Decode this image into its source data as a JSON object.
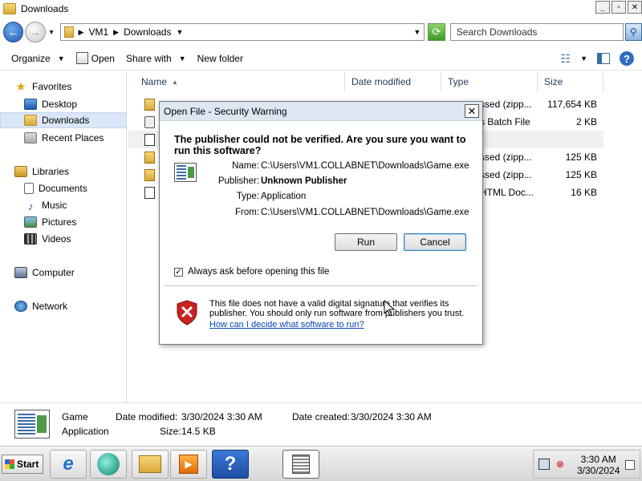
{
  "window": {
    "title": "Downloads"
  },
  "address": {
    "crumbs": [
      "VM1",
      "Downloads"
    ],
    "search_placeholder": "Search Downloads"
  },
  "toolbar": {
    "organize": "Organize",
    "open": "Open",
    "share_with": "Share with",
    "new_folder": "New folder"
  },
  "nav": {
    "favorites": "Favorites",
    "desktop": "Desktop",
    "downloads": "Downloads",
    "recent_places": "Recent Places",
    "libraries": "Libraries",
    "documents": "Documents",
    "music": "Music",
    "pictures": "Pictures",
    "videos": "Videos",
    "computer": "Computer",
    "network": "Network"
  },
  "columns": {
    "name": "Name",
    "date_modified": "Date modified",
    "type": "Type",
    "size": "Size"
  },
  "files": [
    {
      "type": "ssed (zipp...",
      "size": "117,654 KB",
      "icon": "zip-folder-icon"
    },
    {
      "type": "s Batch File",
      "size": "2 KB",
      "icon": "batch-file-icon"
    },
    {
      "type": "",
      "size": "",
      "icon": "exe-file-icon"
    },
    {
      "type": "ssed (zipp...",
      "size": "125 KB",
      "icon": "zip-folder-icon"
    },
    {
      "type": "ssed (zipp...",
      "size": "125 KB",
      "icon": "zip-folder-icon"
    },
    {
      "type": "HTML Doc...",
      "size": "16 KB",
      "icon": "html-file-icon"
    }
  ],
  "dialog": {
    "title": "Open File - Security Warning",
    "question": "The publisher could not be verified.  Are you sure you want to run this software?",
    "name_label": "Name:",
    "name_value": "C:\\Users\\VM1.COLLABNET\\Downloads\\Game.exe",
    "publisher_label": "Publisher:",
    "publisher_value": "Unknown Publisher",
    "type_label": "Type:",
    "type_value": "Application",
    "from_label": "From:",
    "from_value": "C:\\Users\\VM1.COLLABNET\\Downloads\\Game.exe",
    "run": "Run",
    "cancel": "Cancel",
    "checkbox_label": "Always ask before opening this file",
    "checkbox_checked": true,
    "warning": "This file does not have a valid digital signature that verifies its publisher.  You should only run software from publishers you trust.",
    "link": "How can I decide what software to run?"
  },
  "details": {
    "name": "Game",
    "type": "Application",
    "date_modified_label": "Date modified:",
    "date_modified": "3/30/2024 3:30 AM",
    "size_label": "Size:",
    "size": "14.5 KB",
    "date_created_label": "Date created:",
    "date_created": "3/30/2024 3:30 AM"
  },
  "taskbar": {
    "start": "Start",
    "time": "3:30 AM",
    "date": "3/30/2024"
  }
}
